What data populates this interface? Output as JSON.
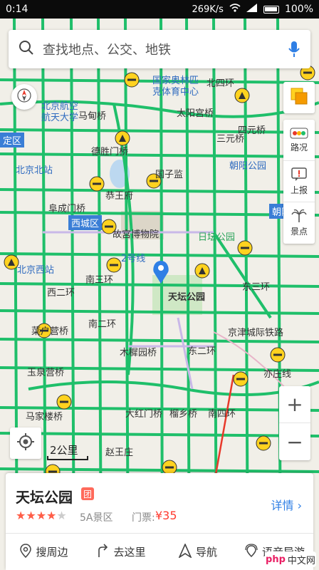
{
  "status_bar": {
    "time": "0:14",
    "speed": "269K/s",
    "battery": "100%"
  },
  "search": {
    "placeholder": "查找地点、公交、地铁"
  },
  "toolbar": {
    "traffic": "路况",
    "report": "上报",
    "scenic": "景点"
  },
  "map": {
    "labels": [
      {
        "text": "国家奥林匹",
        "cls": "blue"
      },
      {
        "text": "克体育中心",
        "cls": "blue"
      },
      {
        "text": "北京航空",
        "cls": "blue"
      },
      {
        "text": "航天大学",
        "cls": "blue"
      },
      {
        "text": "马甸桥",
        "cls": ""
      },
      {
        "text": "太阳宫桥",
        "cls": ""
      },
      {
        "text": "四元桥",
        "cls": ""
      },
      {
        "text": "北四环",
        "cls": ""
      },
      {
        "text": "德胜门桥",
        "cls": ""
      },
      {
        "text": "三元桥",
        "cls": ""
      },
      {
        "text": "国子监",
        "cls": ""
      },
      {
        "text": "朝阳公园",
        "cls": "blue"
      },
      {
        "text": "北京北站",
        "cls": "blue"
      },
      {
        "text": "恭王府",
        "cls": ""
      },
      {
        "text": "阜成门桥",
        "cls": ""
      },
      {
        "text": "故宫博物院",
        "cls": ""
      },
      {
        "text": "日坛公园",
        "cls": "green"
      },
      {
        "text": "2号线",
        "cls": "blue"
      },
      {
        "text": "北京西站",
        "cls": "blue"
      },
      {
        "text": "天坛公园",
        "cls": "bold"
      },
      {
        "text": "菜户营桥",
        "cls": ""
      },
      {
        "text": "南二环",
        "cls": ""
      },
      {
        "text": "木樨园桥",
        "cls": ""
      },
      {
        "text": "玉泉营桥",
        "cls": ""
      },
      {
        "text": "马家楼桥",
        "cls": ""
      },
      {
        "text": "大红门桥",
        "cls": ""
      },
      {
        "text": "榴乡桥",
        "cls": ""
      },
      {
        "text": "南四环",
        "cls": ""
      },
      {
        "text": "赵王庄",
        "cls": ""
      },
      {
        "text": "东二环",
        "cls": ""
      },
      {
        "text": "东三环",
        "cls": ""
      },
      {
        "text": "京津城际铁路",
        "cls": ""
      },
      {
        "text": "亦庄线",
        "cls": ""
      },
      {
        "text": "西二环",
        "cls": ""
      },
      {
        "text": "南三环",
        "cls": ""
      }
    ],
    "districts": {
      "xicheng": "西城区",
      "chaoyang": "朝阳区",
      "haidian": "定区"
    },
    "scale": "2公里"
  },
  "poi": {
    "name": "天坛公园",
    "tag": "团",
    "rating": 4,
    "rating_max": 5,
    "level": "5A景区",
    "price_label": "门票:",
    "price": "¥35",
    "detail": "详情"
  },
  "actions": {
    "nearby": "搜周边",
    "go_here": "去这里",
    "navigate": "导航",
    "voice": "语音导游"
  },
  "watermark": {
    "php": "php",
    "site": "中文网"
  },
  "colors": {
    "road_green": "#1fbf6a",
    "accent_blue": "#2f7fe5",
    "price_red": "#ff3b30",
    "arrow_red": "#e8392a"
  }
}
